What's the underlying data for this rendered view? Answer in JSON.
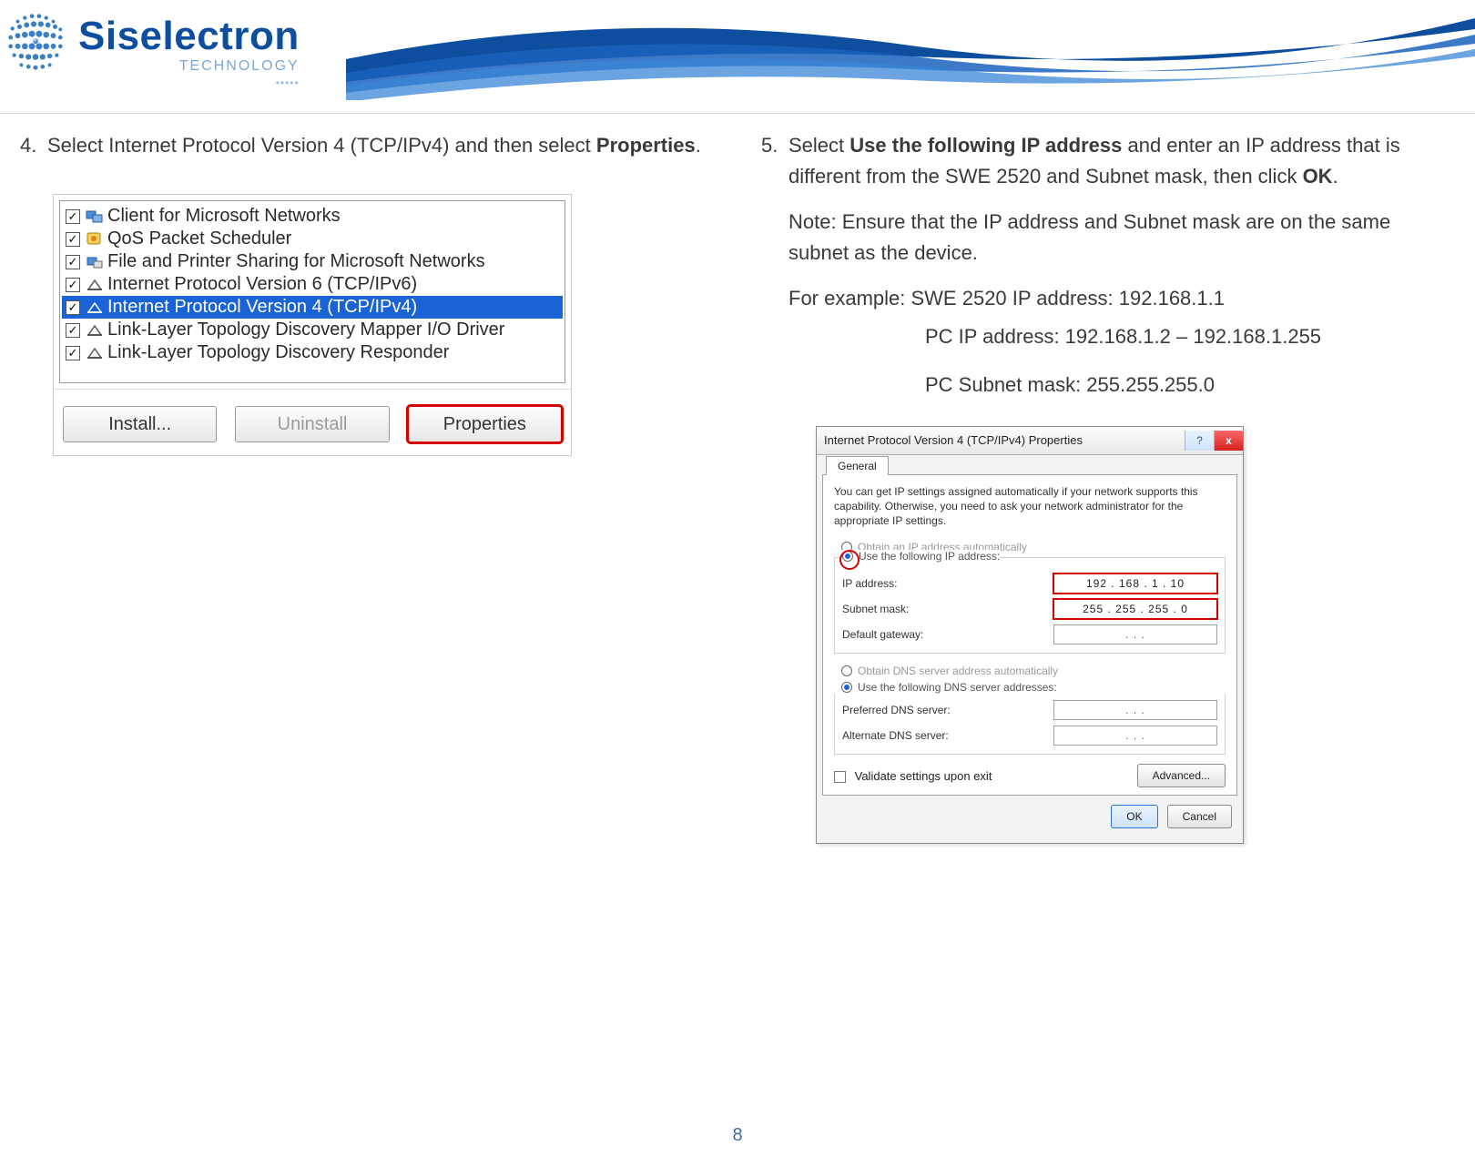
{
  "brand": {
    "name": "Siselectron",
    "sub": "TECHNOLOGY",
    "dots": "•••••"
  },
  "page_number": "8",
  "left": {
    "step_num": "4.",
    "step_pre": "Select ",
    "step_bold1": "Internet  Protocol Version ",
    "step_mid1": "4  (TCP/IPv4)  and ",
    "step_mid2": "then select ",
    "step_bold2": "Properties",
    "step_end": ".",
    "net_items": [
      {
        "label": "Client for Microsoft Networks",
        "icon": "client"
      },
      {
        "label": "QoS Packet Scheduler",
        "icon": "qos"
      },
      {
        "label": "File and Printer Sharing for Microsoft Networks",
        "icon": "share"
      },
      {
        "label": "Internet Protocol Version 6 (TCP/IPv6)",
        "icon": "proto"
      },
      {
        "label": "Internet Protocol Version 4 (TCP/IPv4)",
        "icon": "proto",
        "selected": true
      },
      {
        "label": "Link-Layer Topology Discovery Mapper I/O Driver",
        "icon": "proto"
      },
      {
        "label": "Link-Layer Topology Discovery Responder",
        "icon": "proto"
      }
    ],
    "buttons": {
      "install": "Install...",
      "uninstall": "Uninstall",
      "properties": "Properties"
    }
  },
  "right": {
    "step_num": "5.",
    "step_text_parts": {
      "a": "Select  ",
      "b": "Use  the  following IP address",
      "c": " and  enter an  IP address that  is different from the  SWE 2520  and Subnet mask, then  click ",
      "d": "OK",
      "e": "."
    },
    "note": "Note:  Ensure that the IP address and Subnet  mask are on the same subnet as the  device.",
    "example_line": "For example:  SWE 2520  IP address: 192.168.1.1",
    "pc_ip_line": "PC IP address: 192.168.1.2 – 192.168.1.255",
    "pc_subnet_line": "PC Subnet  mask: 255.255.255.0",
    "dialog": {
      "title": "Internet Protocol Version 4 (TCP/IPv4) Properties",
      "help_glyph": "?",
      "close_glyph": "x",
      "tab": "General",
      "desc": "You can get IP settings assigned automatically if your network supports this capability. Otherwise, you need to ask your network administrator for the appropriate IP settings.",
      "radio_auto_ip": "Obtain an IP address automatically",
      "radio_use_ip": "Use the following IP address:",
      "fields": {
        "ip_label": "IP address:",
        "ip_value": "192 . 168 .  1  . 10",
        "subnet_label": "Subnet mask:",
        "subnet_value": "255 . 255 . 255 .  0",
        "gw_label": "Default gateway:",
        "gw_value": ".     .     ."
      },
      "radio_auto_dns": "Obtain DNS server address automatically",
      "radio_use_dns": "Use the following DNS server addresses:",
      "dns": {
        "pref_label": "Preferred DNS server:",
        "pref_value": ".     .     .",
        "alt_label": "Alternate DNS server:",
        "alt_value": ".     .     ."
      },
      "validate": "Validate settings upon exit",
      "advanced": "Advanced...",
      "ok": "OK",
      "cancel": "Cancel"
    }
  }
}
